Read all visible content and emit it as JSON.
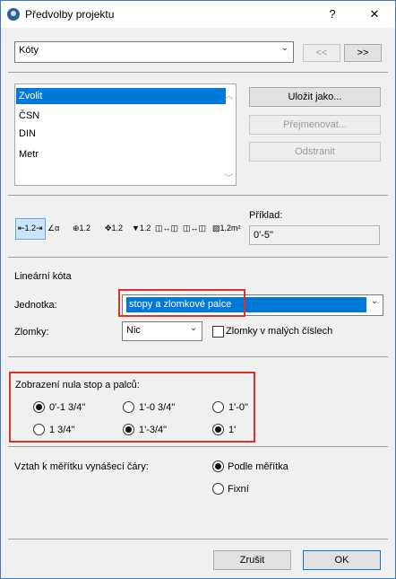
{
  "window": {
    "title": "Předvolby projektu",
    "help": "?",
    "close": "✕"
  },
  "category": {
    "value": "Kóty",
    "prev": "<<",
    "next": ">>"
  },
  "presets": {
    "items": [
      "Zvolit",
      "ČSN",
      "DIN",
      "Metr"
    ],
    "selected_index": 0,
    "save_as": "Uložit jako...",
    "rename": "Přejmenovat...",
    "delete": "Odstranit"
  },
  "tools": {
    "icons": [
      "linear-dimension-icon",
      "angle-dimension-icon",
      "radial-dimension-icon",
      "level-dimension-icon",
      "elevation-marker-icon",
      "door-window-dimension-icon",
      "sill-height-icon",
      "area-dimension-icon"
    ],
    "glyphs": [
      "⇤1.2⇥",
      "∠α",
      "⊕1.2",
      "✥1.2",
      "▼1.2",
      "◫↔◫",
      "◫↔◫",
      "▨1.2m²"
    ],
    "preview_label": "Příklad:",
    "preview_value": "0'-5\""
  },
  "linear": {
    "section_title": "Lineární kóta",
    "unit_label": "Jednotka:",
    "unit_value": "stopy a zlomkové palce",
    "fractions_label": "Zlomky:",
    "fractions_value": "Nic",
    "small_digits_label": "Zlomky v malých číslech",
    "small_digits_checked": false
  },
  "zero_display": {
    "title": "Zobrazení nula stop a palců:",
    "options": [
      "0'-1 3/4\"",
      "1'-0 3/4\"",
      "1'-0\"",
      "1 3/4\"",
      "1'-3/4\"",
      "1'"
    ],
    "selected": [
      true,
      false,
      false,
      false,
      true,
      true
    ]
  },
  "scale": {
    "label": "Vztah k měřítku vynášecí čáry:",
    "options": [
      "Podle měřítka",
      "Fixní"
    ],
    "selected_index": 0
  },
  "footer": {
    "cancel": "Zrušit",
    "ok": "OK"
  }
}
